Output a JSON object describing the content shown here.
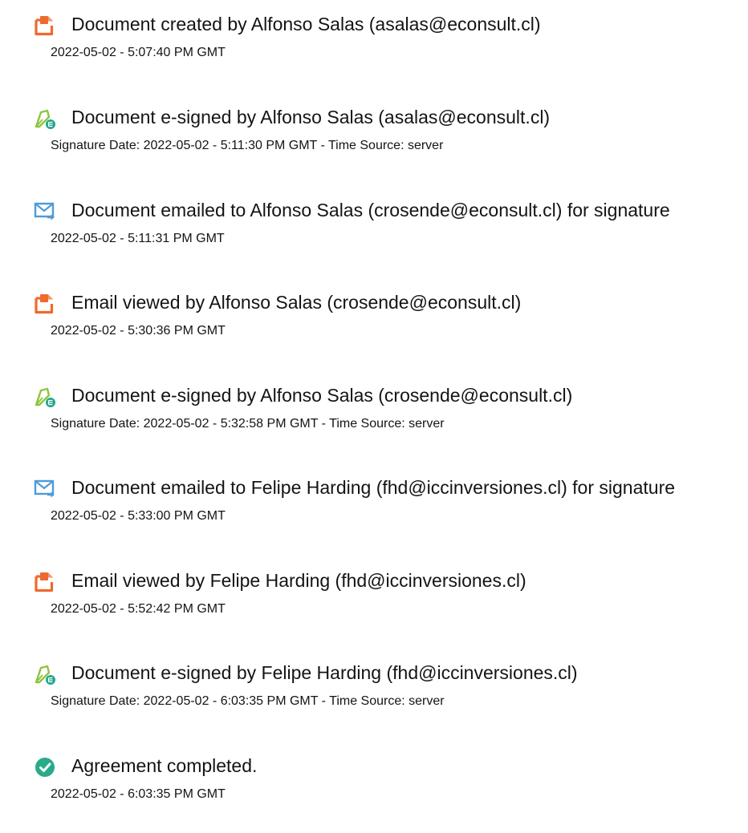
{
  "events": [
    {
      "icon": "document-created-icon",
      "title": "Document created by Alfonso Salas (asalas@econsult.cl)",
      "subtitle": "2022-05-02 - 5:07:40 PM GMT"
    },
    {
      "icon": "e-signature-icon",
      "title": "Document e-signed by Alfonso Salas (asalas@econsult.cl)",
      "subtitle": "Signature Date: 2022-05-02 - 5:11:30 PM GMT - Time Source: server"
    },
    {
      "icon": "email-sent-icon",
      "title": "Document emailed to Alfonso Salas (crosende@econsult.cl) for signature",
      "subtitle": "2022-05-02 - 5:11:31 PM GMT"
    },
    {
      "icon": "document-viewed-icon",
      "title": "Email viewed by Alfonso Salas (crosende@econsult.cl)",
      "subtitle": "2022-05-02 - 5:30:36 PM GMT"
    },
    {
      "icon": "e-signature-icon",
      "title": "Document e-signed by Alfonso Salas (crosende@econsult.cl)",
      "subtitle": "Signature Date: 2022-05-02 - 5:32:58 PM GMT - Time Source: server"
    },
    {
      "icon": "email-sent-icon",
      "title": "Document emailed to Felipe Harding (fhd@iccinversiones.cl) for signature",
      "subtitle": "2022-05-02 - 5:33:00 PM GMT"
    },
    {
      "icon": "document-viewed-icon",
      "title": "Email viewed by Felipe Harding (fhd@iccinversiones.cl)",
      "subtitle": "2022-05-02 - 5:52:42 PM GMT"
    },
    {
      "icon": "e-signature-icon",
      "title": "Document e-signed by Felipe Harding (fhd@iccinversiones.cl)",
      "subtitle": "Signature Date: 2022-05-02 - 6:03:35 PM GMT - Time Source: server"
    },
    {
      "icon": "agreement-completed-icon",
      "title": "Agreement completed.",
      "subtitle": "2022-05-02 - 6:03:35 PM GMT"
    }
  ],
  "colors": {
    "text": "#141414",
    "document_icon": "#ee6a2f",
    "signature_icon_pen": "#8fc43f",
    "signature_icon_badge": "#1fa68a",
    "email_icon": "#4d9bd8",
    "completed_icon": "#2aaa8a"
  }
}
